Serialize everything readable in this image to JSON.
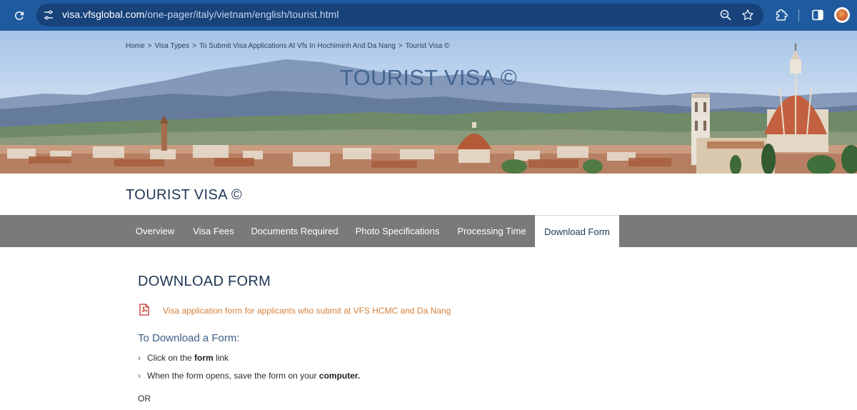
{
  "browser": {
    "url_domain": "visa.vfsglobal.com",
    "url_path": "/one-pager/italy/vietnam/english/tourist.html"
  },
  "breadcrumb": {
    "items": [
      "Home",
      "Visa Types",
      "To Submit Visa Applications At Vfs In Hochiminh And Da Nang",
      "Tourist Visa ©"
    ],
    "separator": ">"
  },
  "hero": {
    "title": "TOURIST VISA ©"
  },
  "page": {
    "title": "TOURIST VISA ©"
  },
  "tabs": [
    {
      "label": "Overview"
    },
    {
      "label": "Visa Fees"
    },
    {
      "label": "Documents Required"
    },
    {
      "label": "Photo Specifications"
    },
    {
      "label": "Processing Time"
    },
    {
      "label": "Download Form",
      "active": true
    }
  ],
  "content": {
    "heading": "DOWNLOAD FORM",
    "form_link": "Visa application form for applicants who submit at VFS HCMC and Da Nang",
    "subheading": "To Download a Form:",
    "steps": [
      {
        "pre": "Click on the ",
        "bold": "form",
        "post": " link"
      },
      {
        "pre": "When the form opens, save the form on your ",
        "bold": "computer.",
        "post": ""
      }
    ],
    "or": "OR"
  },
  "colors": {
    "chrome": "#1f5a9e",
    "tab_bar": "#7a7a7a",
    "heading": "#1e3553",
    "link": "#d5803c"
  }
}
